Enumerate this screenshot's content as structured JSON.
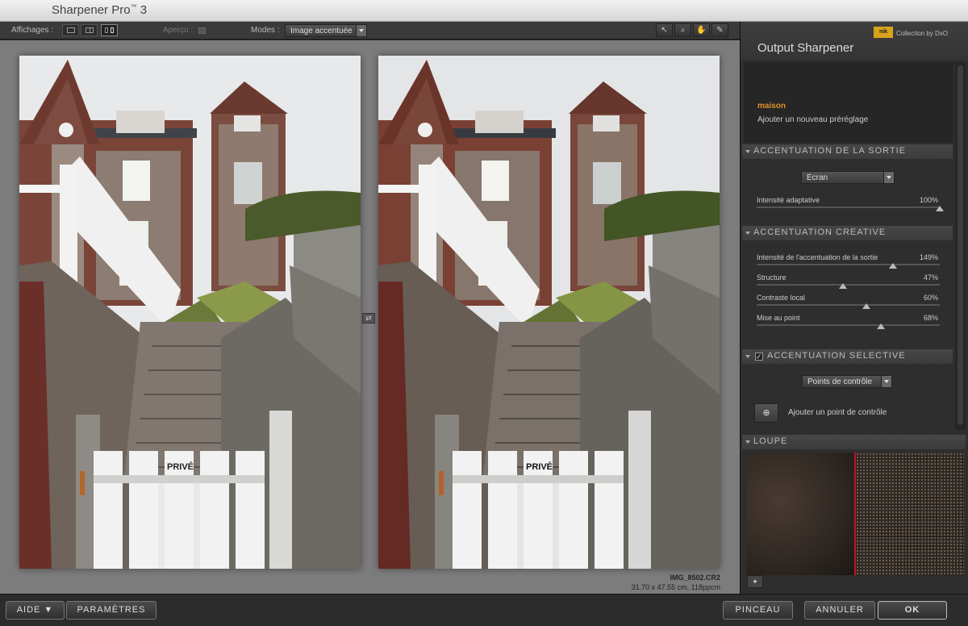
{
  "app": {
    "title": "Sharpener Pro",
    "tm": "™",
    "version": "3"
  },
  "toolbar": {
    "views_label": "Affichages :",
    "preview_label": "Aperçu :",
    "modes_label": "Modes :",
    "mode_value": "Image accentuée"
  },
  "image": {
    "sign_text": "PRIVÉ",
    "filename": "IMG_8502.CR2",
    "dims": "31.70 x 47.55 cm, 118ppcm"
  },
  "panel": {
    "title": "Output Sharpener",
    "brand_logo": "nik",
    "brand_text": "Collection by DxO",
    "preset_name": "maison",
    "preset_add": "Ajouter un nouveau préréglage",
    "output": {
      "header": "ACCENTUATION DE LA SORTIE",
      "dropdown": "Ecran",
      "slider": {
        "label": "Intensité adaptative",
        "value_text": "100%",
        "value": 100
      }
    },
    "creative": {
      "header": "ACCENTUATION CREATIVE",
      "sliders": [
        {
          "label": "Intensité de l'accentuation de la sortie",
          "value_text": "149%",
          "value": 149
        },
        {
          "label": "Structure",
          "value_text": "47%",
          "value": 47
        },
        {
          "label": "Contraste local",
          "value_text": "60%",
          "value": 60
        },
        {
          "label": "Mise au point",
          "value_text": "68%",
          "value": 68
        }
      ]
    },
    "selective": {
      "header": "ACCENTUATION SELECTIVE",
      "checked": true,
      "dropdown": "Points de contrôle",
      "add_label": "Ajouter un point de contrôle"
    },
    "loupe": {
      "header": "LOUPE"
    }
  },
  "buttons": {
    "help": "AIDE ▼",
    "settings": "PARAMÈTRES",
    "brush": "PINCEAU",
    "cancel": "ANNULER",
    "ok": "OK"
  }
}
